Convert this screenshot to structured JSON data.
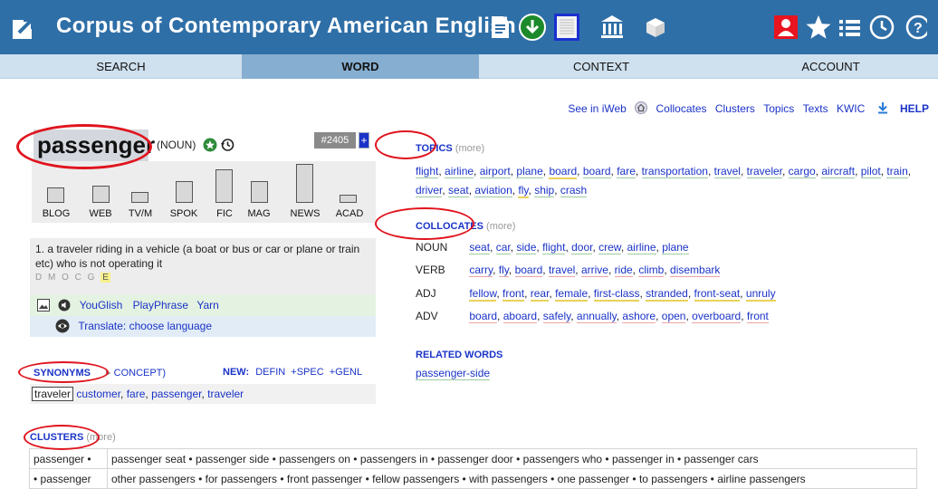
{
  "header": {
    "title": "Corpus of Contemporary American English"
  },
  "nav": {
    "tabs": [
      "SEARCH",
      "WORD",
      "CONTEXT",
      "ACCOUNT"
    ]
  },
  "toplinks": {
    "see_in": "See in iWeb",
    "collocates": "Collocates",
    "clusters": "Clusters",
    "topics": "Topics",
    "texts": "Texts",
    "kwic": "KWIC",
    "help": "HELP"
  },
  "word": {
    "text": "passenger",
    "pos": "(NOUN)",
    "rank": "#2405",
    "rank_plus": "+"
  },
  "frequency": {
    "genres": [
      "BLOG",
      "WEB",
      "TV/M",
      "SPOK",
      "FIC",
      "MAG",
      "NEWS",
      "ACAD"
    ]
  },
  "definition": {
    "text": "1. a traveler riding in a vehicle (a boat or bus or car or plane or train etc) who is not operating it",
    "genre_letters": "D M O C G",
    "genre_highlight": "E"
  },
  "media": {
    "youglish": "YouGlish",
    "playphrase": "PlayPhrase",
    "yarn": "Yarn"
  },
  "translate": {
    "label": "Translate: choose language"
  },
  "synonyms": {
    "label": "SYNONYMS",
    "concept": "CONCEPT)",
    "new": "NEW:",
    "defin": "DEFIN",
    "spec": "+SPEC",
    "genl": "+GENL",
    "first": "traveler",
    "items": [
      "customer",
      "fare",
      "passenger",
      "traveler"
    ]
  },
  "topics": {
    "label": "TOPICS",
    "more": "(more)",
    "items": [
      "flight",
      "airline",
      "airport",
      "plane",
      "board",
      "board",
      "fare",
      "transportation",
      "travel",
      "traveler",
      "cargo",
      "aircraft",
      "pilot",
      "train",
      "driver",
      "seat",
      "aviation",
      "fly",
      "ship",
      "crash"
    ]
  },
  "collocates": {
    "label": "COLLOCATES",
    "more": "(more)",
    "rows": [
      {
        "pos": "NOUN",
        "items": [
          "seat",
          "car",
          "side",
          "flight",
          "door",
          "crew",
          "airline",
          "plane"
        ]
      },
      {
        "pos": "VERB",
        "items": [
          "carry",
          "fly",
          "board",
          "travel",
          "arrive",
          "ride",
          "climb",
          "disembark"
        ]
      },
      {
        "pos": "ADJ",
        "items": [
          "fellow",
          "front",
          "rear",
          "female",
          "first-class",
          "stranded",
          "front-seat",
          "unruly"
        ]
      },
      {
        "pos": "ADV",
        "items": [
          "board",
          "aboard",
          "safely",
          "annually",
          "ashore",
          "open",
          "overboard",
          "front"
        ]
      }
    ]
  },
  "related": {
    "label": "RELATED WORDS",
    "items": [
      "passenger-side"
    ]
  },
  "clusters": {
    "label": "CLUSTERS",
    "more": "(more)",
    "rows": [
      {
        "key": "passenger •",
        "items": [
          "passenger seat",
          "passenger side",
          "passengers on",
          "passengers in",
          "passenger door",
          "passengers who",
          "passenger in",
          "passenger cars"
        ]
      },
      {
        "key": "• passenger",
        "items": [
          "other passengers",
          "for passengers",
          "front passenger",
          "fellow passengers",
          "with passengers",
          "one passenger",
          "to passengers",
          "airline passengers"
        ]
      }
    ]
  }
}
